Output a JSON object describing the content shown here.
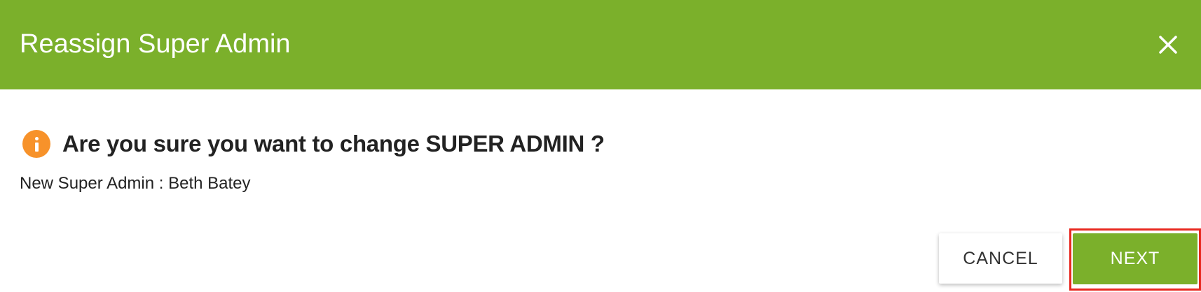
{
  "dialog": {
    "title": "Reassign Super Admin",
    "close_icon": "close-icon",
    "question": "Are you sure you want to change SUPER ADMIN ?",
    "info_icon": "info-icon",
    "detail": "New Super Admin : Beth Batey"
  },
  "buttons": {
    "cancel_label": "CANCEL",
    "next_label": "NEXT"
  },
  "colors": {
    "header_bg": "#7bb02b",
    "primary_button": "#7bb02b",
    "info_icon": "#f7922a",
    "highlight_border": "#e8281f"
  }
}
